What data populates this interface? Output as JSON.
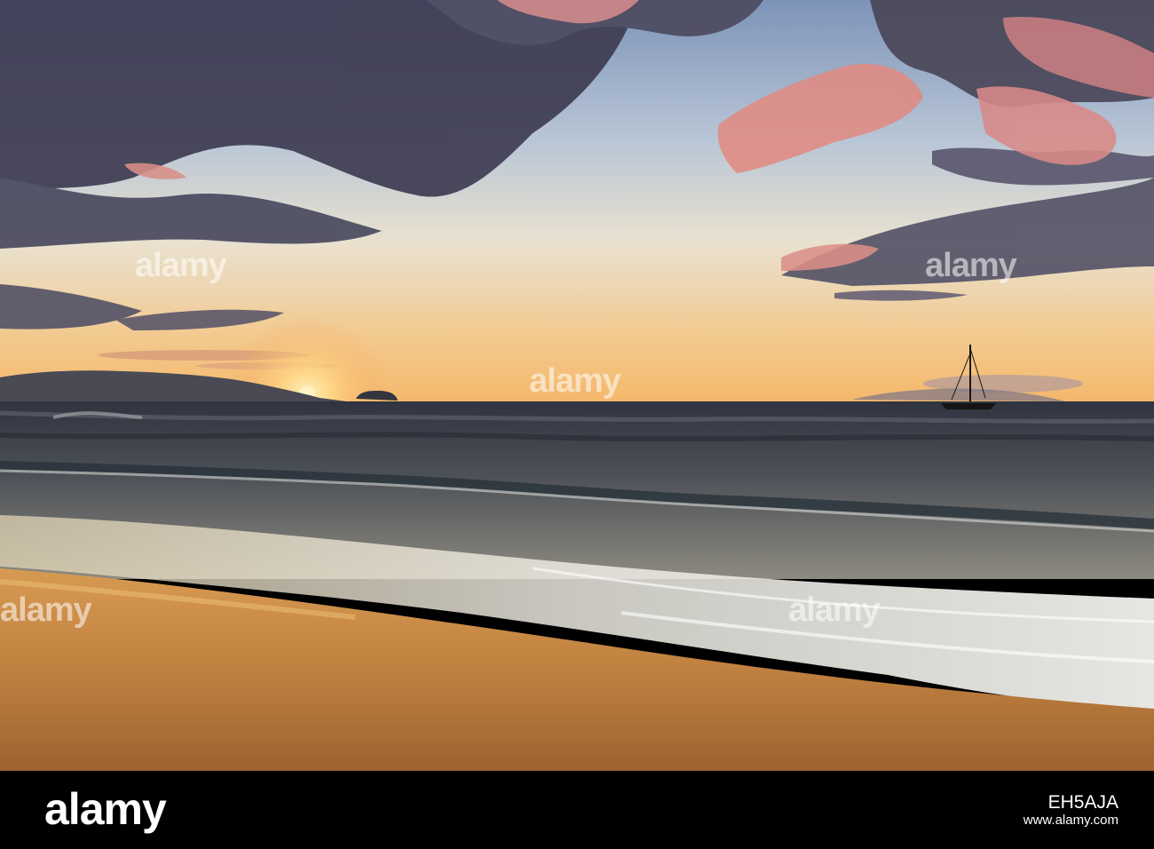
{
  "photo": {
    "watermark_text": "alamy",
    "colors": {
      "sky_top": "#7d93b8",
      "sky_mid": "#e9e1cf",
      "horizon_glow": "#f4b76a",
      "sun": "#ffd98a",
      "cloud_dark": "#3e3c52",
      "cloud_pink": "#e08a82",
      "ocean_far": "#3a3e4a",
      "ocean_near": "#8d8a80",
      "foam": "#e8e6df",
      "sand_light": "#d79a52",
      "sand_dark": "#9c6330"
    },
    "elements": [
      "sunset-sky",
      "clouds",
      "sun",
      "island-silhouette",
      "small-islet",
      "sailboat",
      "ocean-waves",
      "surf-foam",
      "sand-beach"
    ]
  },
  "footer": {
    "brand": "alamy",
    "image_id": "EH5AJA",
    "site": "www.alamy.com"
  }
}
